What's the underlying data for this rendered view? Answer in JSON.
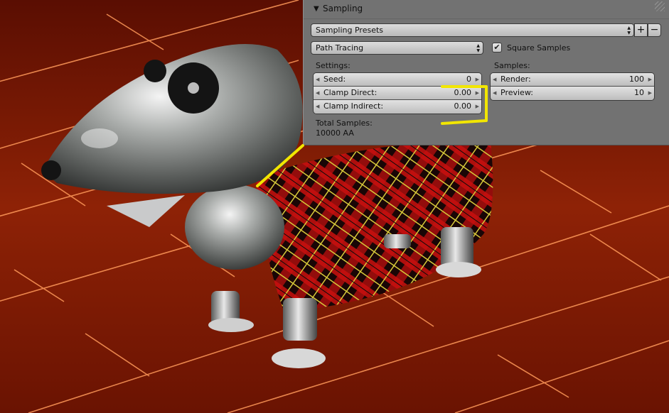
{
  "panel": {
    "title": "Sampling",
    "presets_label": "Sampling Presets",
    "add_symbol": "+",
    "remove_symbol": "−",
    "integrator": "Path Tracing",
    "square_samples_label": "Square Samples",
    "square_samples_checked": true,
    "settings_label": "Settings:",
    "samples_label": "Samples:",
    "settings": {
      "seed_label": "Seed:",
      "seed_value": "0",
      "clamp_direct_label": "Clamp Direct:",
      "clamp_direct_value": "0.00",
      "clamp_indirect_label": "Clamp Indirect:",
      "clamp_indirect_value": "0.00"
    },
    "samples": {
      "render_label": "Render:",
      "render_value": "100",
      "preview_label": "Preview:",
      "preview_value": "10"
    },
    "total_samples_label": "Total Samples:",
    "total_samples_value": "10000 AA"
  },
  "colors": {
    "panel_bg": "#727272",
    "annotation": "#f2e600",
    "floor": "#8a1a05"
  },
  "icons": {
    "collapse": "triangle-down-icon",
    "spin": "up-down-arrows-icon",
    "check": "checkmark-icon"
  }
}
